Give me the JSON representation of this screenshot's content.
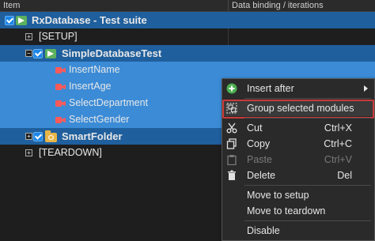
{
  "header": {
    "col_item": "Item",
    "col_binding": "Data binding / iterations"
  },
  "tree": {
    "suite": "RxDatabase - Test suite",
    "setup": "[SETUP]",
    "test_case": "SimpleDatabaseTest",
    "modules": [
      "InsertName",
      "InsertAge",
      "SelectDepartment",
      "SelectGender"
    ],
    "smart_folder": "SmartFolder",
    "teardown": "[TEARDOWN]"
  },
  "context_menu": {
    "insert_after": "Insert after",
    "group_selected": "Group selected modules",
    "cut": "Cut",
    "cut_shortcut": "Ctrl+X",
    "copy": "Copy",
    "copy_shortcut": "Ctrl+C",
    "paste": "Paste",
    "paste_shortcut": "Ctrl+V",
    "delete": "Delete",
    "delete_shortcut": "Del",
    "move_to_setup": "Move to setup",
    "move_to_teardown": "Move to teardown",
    "disable": "Disable"
  },
  "colors": {
    "selection": "#3b8bd6",
    "highlight_border": "#c93a3a",
    "module_icon": "#ff5a5a",
    "suite_icon": "#5db15d",
    "folder_icon": "#e8b548"
  }
}
